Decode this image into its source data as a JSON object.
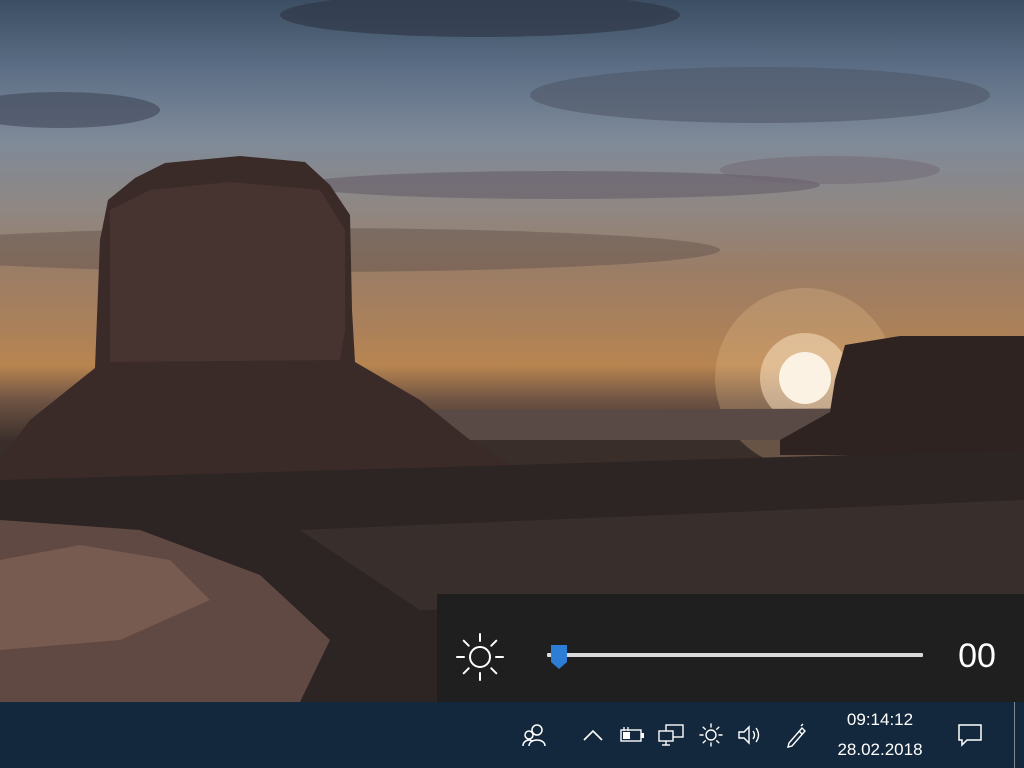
{
  "brightness_flyout": {
    "value": "00",
    "level_fraction": 0.03,
    "accent_color": "#2d7cd6"
  },
  "tray": {
    "icons": [
      "people-icon",
      "chevron-up-icon",
      "battery-icon",
      "network-icon",
      "brightness-icon",
      "volume-icon",
      "pen-icon",
      "notification-icon"
    ]
  },
  "clock": {
    "time": "09:14:12",
    "date": "28.02.2018"
  },
  "colors": {
    "taskbar": "#14283d",
    "flyout": "#1f1f1f"
  }
}
